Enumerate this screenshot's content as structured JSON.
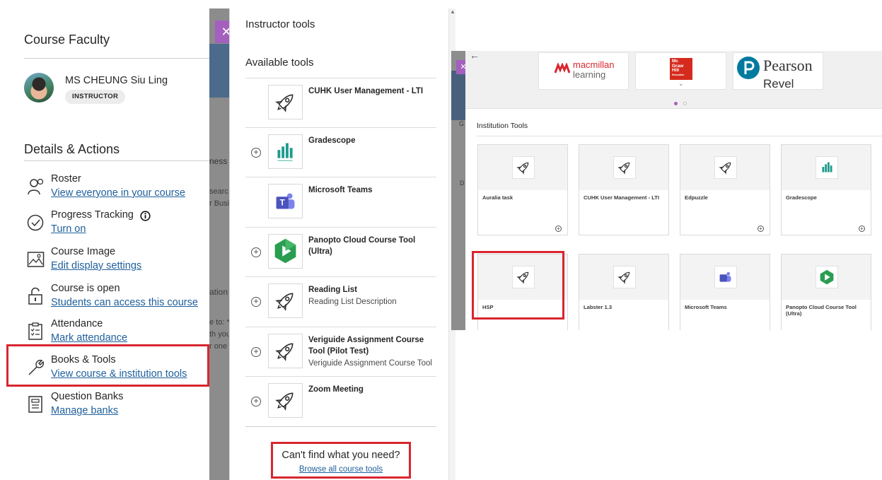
{
  "left": {
    "faculty_title": "Course Faculty",
    "faculty_name": "MS CHEUNG Siu Ling",
    "faculty_role": "INSTRUCTOR",
    "details_title": "Details & Actions",
    "actions": [
      {
        "title": "Roster",
        "link": "View everyone in your course",
        "icon": "roster-icon"
      },
      {
        "title": "Progress Tracking",
        "link": "Turn on",
        "icon": "progress-icon"
      },
      {
        "title": "Course Image",
        "link": "Edit display settings",
        "icon": "image-icon"
      },
      {
        "title": "Course is open",
        "link": "Students can access this course",
        "icon": "unlock-icon"
      },
      {
        "title": "Attendance",
        "link": "Mark attendance",
        "icon": "attendance-icon"
      },
      {
        "title": "Books & Tools",
        "link": "View course & institution tools",
        "icon": "wrench-icon"
      },
      {
        "title": "Question Banks",
        "link": "Manage banks",
        "icon": "question-bank-icon"
      }
    ]
  },
  "background_peek": {
    "frag1": "ness",
    "frag2": "searc",
    "frag3": "r Busi",
    "frag4": "ation",
    "frag5": "e to: *",
    "frag6": "th you",
    "frag7": "r one",
    "frag8": "G",
    "frag9": "D"
  },
  "instructor_tools": {
    "title": "Instructor tools",
    "available_title": "Available tools",
    "tools": [
      {
        "name": "CUHK User Management - LTI",
        "desc": "",
        "icon": "rocket-icon",
        "has_add": false
      },
      {
        "name": "Gradescope",
        "desc": "",
        "icon": "gradescope-icon",
        "has_add": true
      },
      {
        "name": "Microsoft Teams",
        "desc": "",
        "icon": "teams-icon",
        "has_add": false
      },
      {
        "name": "Panopto Cloud Course Tool (Ultra)",
        "desc": "",
        "icon": "panopto-icon",
        "has_add": true
      },
      {
        "name": "Reading List",
        "desc": "Reading List Description",
        "icon": "rocket-icon",
        "has_add": true
      },
      {
        "name": "Veriguide Assignment Course Tool (Pilot Test)",
        "desc": "Veriguide Assignment Course Tool",
        "icon": "rocket-icon",
        "has_add": true
      },
      {
        "name": "Zoom Meeting",
        "desc": "",
        "icon": "rocket-icon",
        "has_add": true
      }
    ],
    "cant_find": "Can't find what you need?",
    "browse_link": "Browse all course tools"
  },
  "institution": {
    "publishers": {
      "macmillan_line1": "macmillan",
      "macmillan_line2": "learning",
      "mcgraw_line1": "Mc",
      "mcgraw_line2": "Graw",
      "mcgraw_line3": "Hill",
      "mcgraw_line4": "Education",
      "pearson": "Pearson",
      "revel": "Revel"
    },
    "section_title": "Institution Tools",
    "cards": [
      {
        "name": "Auralia task",
        "icon": "rocket-icon"
      },
      {
        "name": "CUHK User Management - LTI",
        "icon": "rocket-icon"
      },
      {
        "name": "Edpuzzle",
        "icon": "rocket-icon"
      },
      {
        "name": "Gradescope",
        "icon": "gradescope-icon"
      },
      {
        "name": "HSP",
        "icon": "rocket-icon"
      },
      {
        "name": "Labster 1.3",
        "icon": "rocket-icon"
      },
      {
        "name": "Microsoft Teams",
        "icon": "teams-icon"
      },
      {
        "name": "Panopto Cloud Course Tool (Ultra)",
        "icon": "panopto-icon"
      }
    ]
  },
  "colors": {
    "highlight": "#d8262e",
    "link": "#1e5f9c",
    "close_button": "#a45fbf",
    "macmillan": "#d8262e",
    "mcgraw": "#d52b1e",
    "pearson": "#007a9e"
  }
}
